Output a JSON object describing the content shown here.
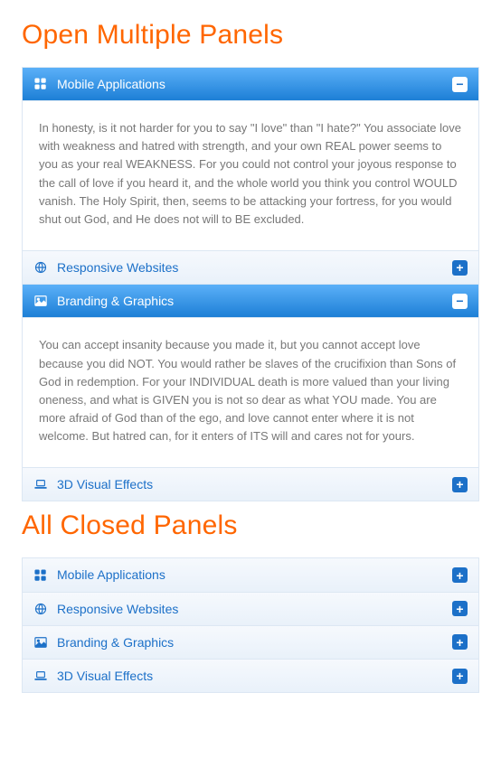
{
  "sections": [
    {
      "heading": "Open Multiple Panels",
      "panels": [
        {
          "icon": "grid-icon",
          "title": "Mobile Applications",
          "state": "open",
          "body": "In honesty, is it not harder for you to say \"I love\" than \"I hate?\" You associate love with weakness and hatred with strength, and your own REAL power seems to you as your real WEAKNESS. For you could not control your joyous response to the call of love if you heard it, and the whole world you think you control WOULD vanish. The Holy Spirit, then, seems to be attacking your fortress, for you would shut out God, and He does not will to BE excluded."
        },
        {
          "icon": "globe-icon",
          "title": "Responsive Websites",
          "state": "closed",
          "body": null
        },
        {
          "icon": "image-icon",
          "title": "Branding & Graphics",
          "state": "open",
          "body": "You can accept insanity because you made it, but you cannot accept love because you did NOT. You would rather be slaves of the crucifixion than Sons of God in redemption. For your INDIVIDUAL death is more valued than your living oneness, and what is GIVEN you is not so dear as what YOU made. You are more afraid of God than of the ego, and love cannot enter where it is not welcome. But hatred can, for it enters of ITS will and cares not for yours."
        },
        {
          "icon": "laptop-icon",
          "title": "3D Visual Effects",
          "state": "closed",
          "body": null
        }
      ]
    },
    {
      "heading": "All Closed Panels",
      "panels": [
        {
          "icon": "grid-icon",
          "title": "Mobile Applications",
          "state": "closed",
          "body": null
        },
        {
          "icon": "globe-icon",
          "title": "Responsive Websites",
          "state": "closed",
          "body": null
        },
        {
          "icon": "image-icon",
          "title": "Branding & Graphics",
          "state": "closed",
          "body": null
        },
        {
          "icon": "laptop-icon",
          "title": "3D Visual Effects",
          "state": "closed",
          "body": null
        }
      ]
    }
  ],
  "glyphs": {
    "expand": "+",
    "collapse": "−"
  }
}
